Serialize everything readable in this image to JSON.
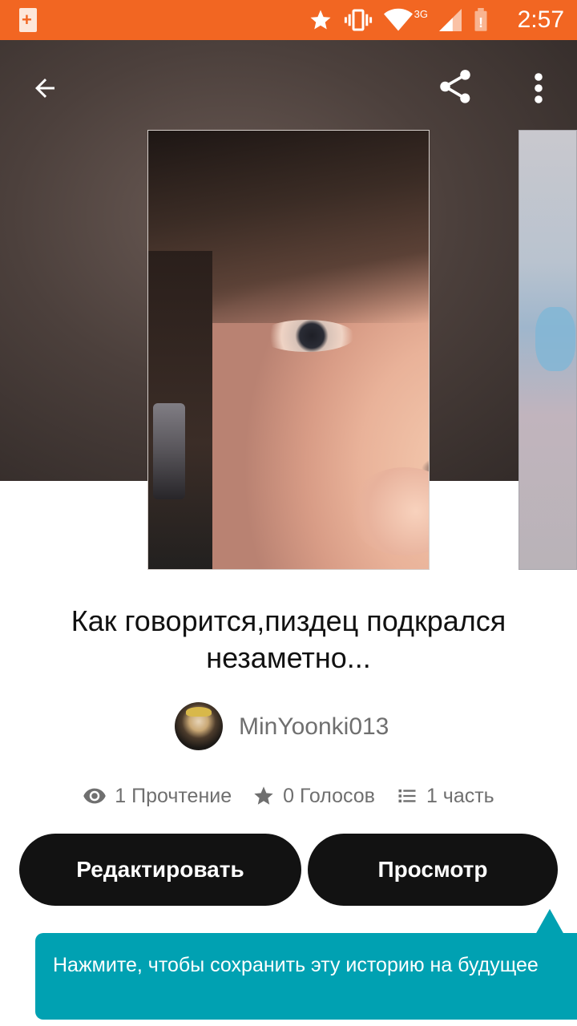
{
  "status_bar": {
    "time": "2:57",
    "network": "3G"
  },
  "story": {
    "title": "Как говорится,пиздец подкрался незаметно...",
    "author": "MinYoonki013"
  },
  "stats": {
    "reads": "1 Прочтение",
    "votes": "0 Голосов",
    "parts": "1 часть"
  },
  "actions": {
    "edit_label": "Редактировать",
    "view_label": "Просмотр"
  },
  "tooltip": {
    "text": "Нажмите, чтобы сохранить эту историю на будущее"
  },
  "colors": {
    "status_bar": "#f26622",
    "tooltip": "#00a1b2",
    "button": "#121212"
  }
}
